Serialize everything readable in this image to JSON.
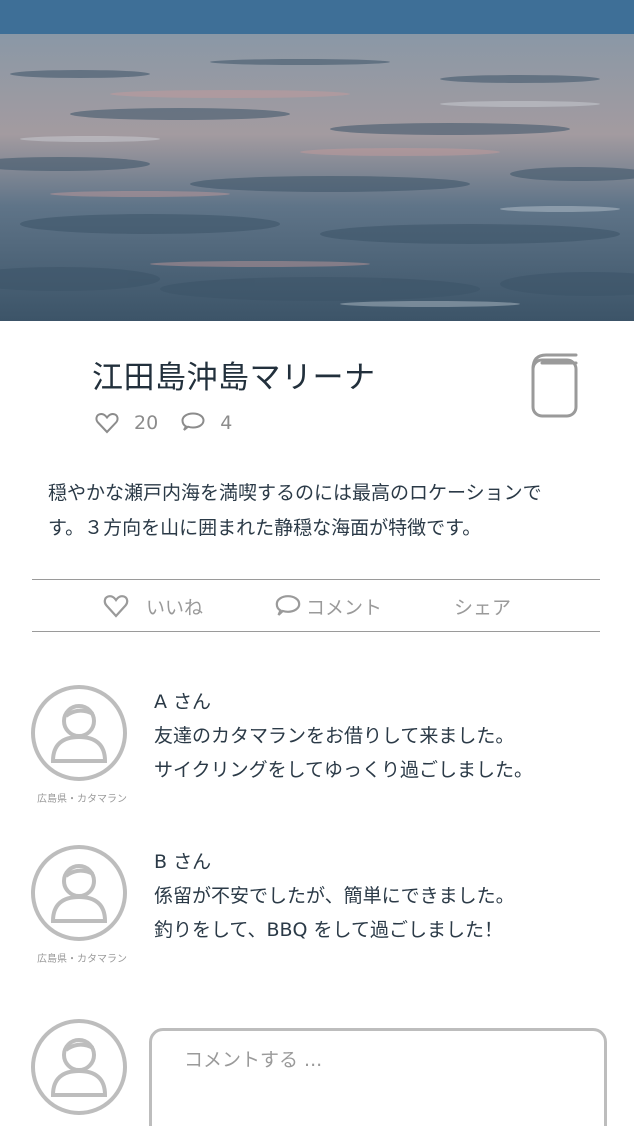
{
  "hero": {
    "image": "sea-surface-photo"
  },
  "spot": {
    "title": "江田島沖島マリーナ",
    "likes": "20",
    "comments": "4",
    "description_lines": [
      "穏やかな瀬戸内海を満喫するのには最高のロケーションで",
      "す。３方向を山に囲まれた静穏な海面が特徴です。"
    ]
  },
  "actions": {
    "like_label": "いいね",
    "comment_label": "コメント",
    "share_label": "シェア"
  },
  "reviews": [
    {
      "author": "A さん",
      "caption": "広島県・カタマラン",
      "lines": [
        "友達のカタマランをお借りして来ました。",
        "サイクリングをしてゆっくり過ごしました。"
      ]
    },
    {
      "author": "B さん",
      "caption": "広島県・カタマラン",
      "lines": [
        "係留が不安でしたが、簡単にできました。",
        "釣りをして、BBQ をして過ごしました！"
      ]
    }
  ],
  "compose": {
    "placeholder": "コメントする ..."
  },
  "colors": {
    "topbar": "#3e6f97",
    "text": "#2b3a47",
    "muted": "#9a9a9a",
    "avatar": "#bdbdbd"
  },
  "icons": [
    "heart-icon",
    "speech-bubble-icon",
    "bookmark-icon",
    "user-avatar-icon"
  ]
}
